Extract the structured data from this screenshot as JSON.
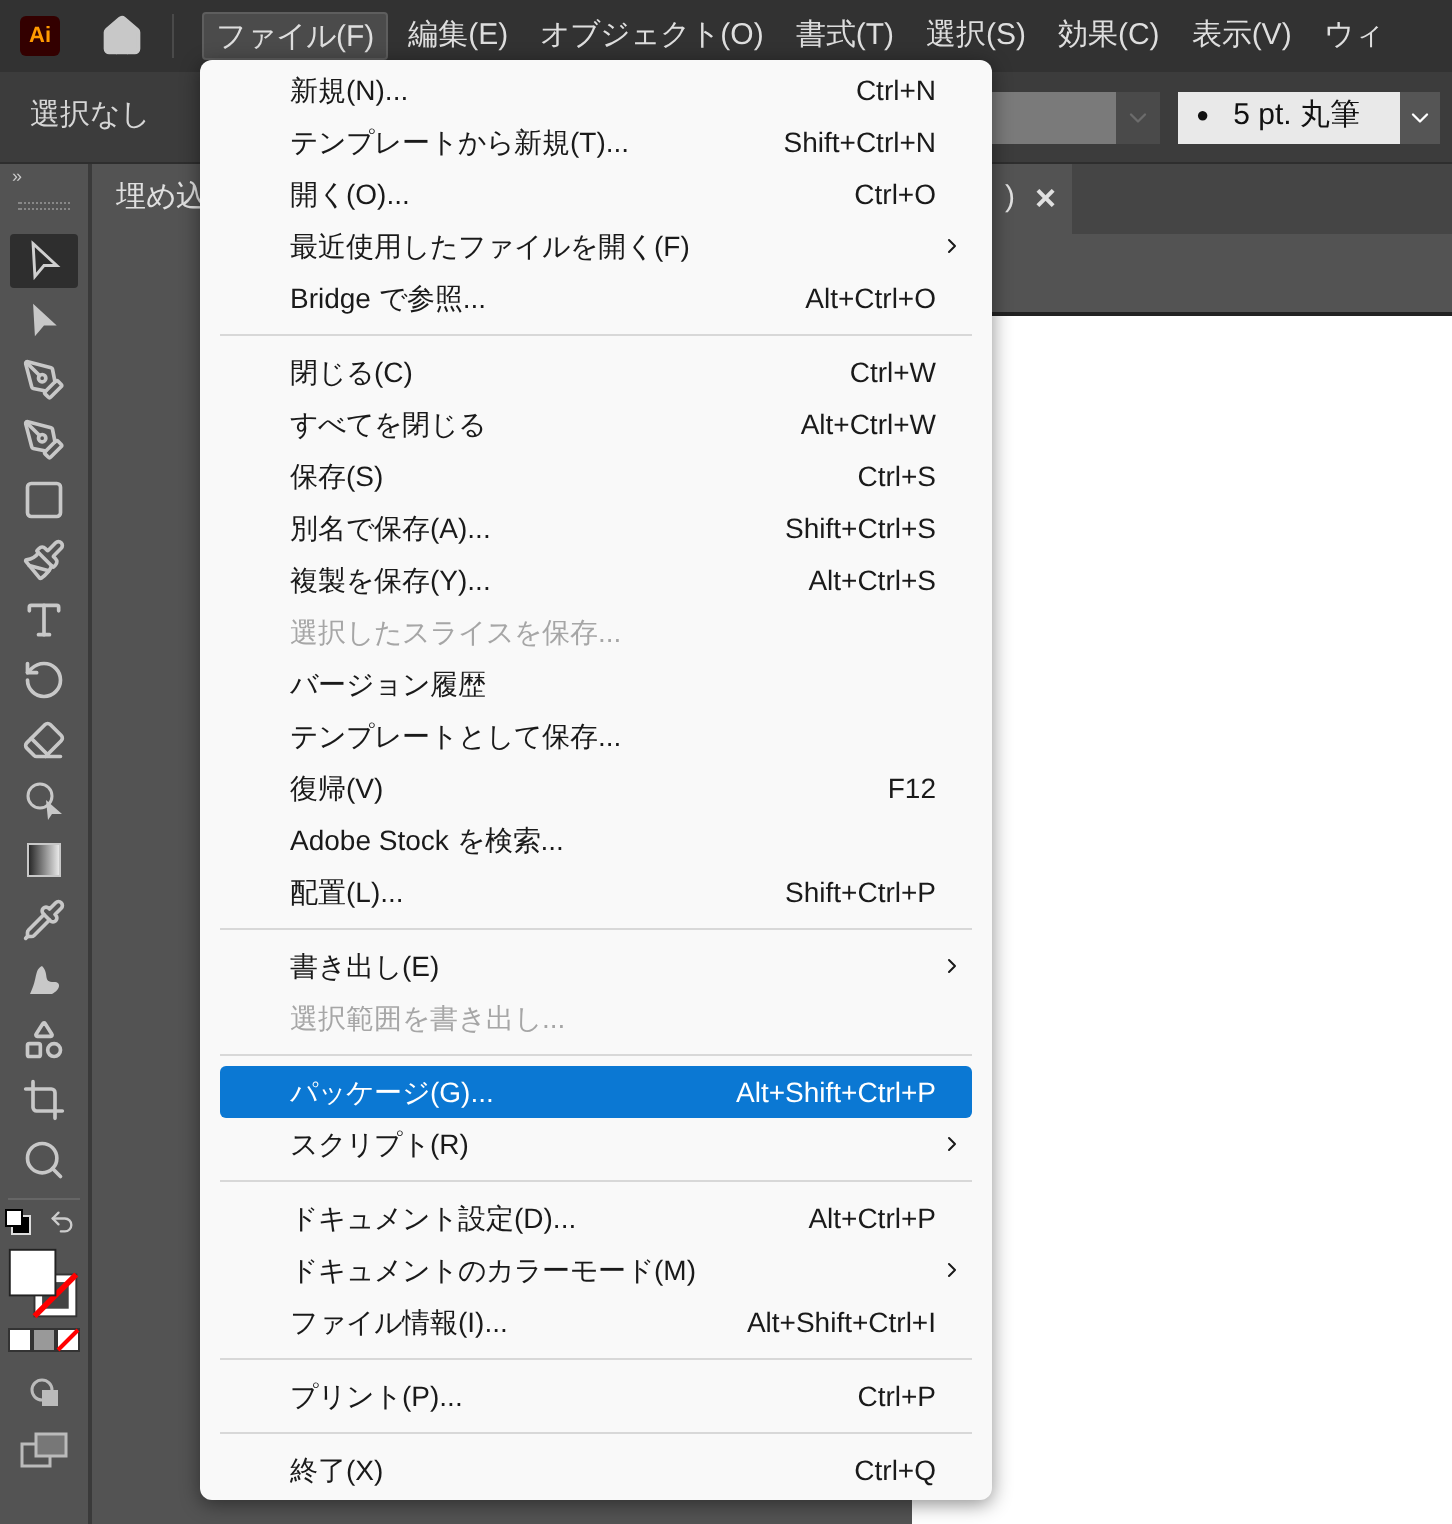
{
  "app_bar": {
    "logo": "Ai",
    "menus": [
      {
        "label": "ファイル(F)",
        "selected": true
      },
      {
        "label": "編集(E)",
        "selected": false
      },
      {
        "label": "オブジェクト(O)",
        "selected": false
      },
      {
        "label": "書式(T)",
        "selected": false
      },
      {
        "label": "選択(S)",
        "selected": false
      },
      {
        "label": "効果(C)",
        "selected": false
      },
      {
        "label": "表示(V)",
        "selected": false
      },
      {
        "label": "ウィ",
        "selected": false
      }
    ]
  },
  "control_bar": {
    "selection_status": "選択なし",
    "brush_field": {
      "bullet": "●",
      "value": "5 pt. 丸筆"
    }
  },
  "tools_panel": {
    "expand": "»"
  },
  "document_tab": {
    "title_start": "埋め込",
    "title_end": ")",
    "close": "×"
  },
  "tools": [
    {
      "kind": "selection",
      "selected": true
    },
    {
      "kind": "direct-selection",
      "selected": false
    },
    {
      "kind": "pen",
      "selected": false
    },
    {
      "kind": "curvature",
      "selected": false
    },
    {
      "kind": "rectangle",
      "selected": false
    },
    {
      "kind": "brush",
      "selected": false
    },
    {
      "kind": "type",
      "selected": false
    },
    {
      "kind": "rotate",
      "selected": false
    },
    {
      "kind": "eraser",
      "selected": false
    },
    {
      "kind": "shape-builder",
      "selected": false
    },
    {
      "kind": "gradient",
      "selected": false
    },
    {
      "kind": "eyedropper",
      "selected": false
    },
    {
      "kind": "puppet",
      "selected": false
    },
    {
      "kind": "shapes",
      "selected": false
    },
    {
      "kind": "artboard",
      "selected": false
    },
    {
      "kind": "zoom",
      "selected": false
    }
  ],
  "file_menu": {
    "items": [
      {
        "kind": "item",
        "label": "新規(N)...",
        "shortcut": "Ctrl+N",
        "submenu": false,
        "disabled": false,
        "selected": false
      },
      {
        "kind": "item",
        "label": "テンプレートから新規(T)...",
        "shortcut": "Shift+Ctrl+N",
        "submenu": false,
        "disabled": false,
        "selected": false
      },
      {
        "kind": "item",
        "label": "開く(O)...",
        "shortcut": "Ctrl+O",
        "submenu": false,
        "disabled": false,
        "selected": false
      },
      {
        "kind": "item",
        "label": "最近使用したファイルを開く(F)",
        "submenu": true,
        "disabled": false,
        "selected": false
      },
      {
        "kind": "item",
        "label": "Bridge で参照...",
        "shortcut": "Alt+Ctrl+O",
        "submenu": false,
        "disabled": false,
        "selected": false
      },
      {
        "kind": "separator"
      },
      {
        "kind": "item",
        "label": "閉じる(C)",
        "shortcut": "Ctrl+W",
        "submenu": false,
        "disabled": false,
        "selected": false
      },
      {
        "kind": "item",
        "label": "すべてを閉じる",
        "shortcut": "Alt+Ctrl+W",
        "submenu": false,
        "disabled": false,
        "selected": false
      },
      {
        "kind": "item",
        "label": "保存(S)",
        "shortcut": "Ctrl+S",
        "submenu": false,
        "disabled": false,
        "selected": false
      },
      {
        "kind": "item",
        "label": "別名で保存(A)...",
        "shortcut": "Shift+Ctrl+S",
        "submenu": false,
        "disabled": false,
        "selected": false
      },
      {
        "kind": "item",
        "label": "複製を保存(Y)...",
        "shortcut": "Alt+Ctrl+S",
        "submenu": false,
        "disabled": false,
        "selected": false
      },
      {
        "kind": "item",
        "label": "選択したスライスを保存...",
        "submenu": false,
        "disabled": true,
        "selected": false
      },
      {
        "kind": "item",
        "label": "バージョン履歴",
        "submenu": false,
        "disabled": false,
        "selected": false
      },
      {
        "kind": "item",
        "label": "テンプレートとして保存...",
        "submenu": false,
        "disabled": false,
        "selected": false
      },
      {
        "kind": "item",
        "label": "復帰(V)",
        "shortcut": "F12",
        "submenu": false,
        "disabled": false,
        "selected": false
      },
      {
        "kind": "item",
        "label": "Adobe Stock を検索...",
        "submenu": false,
        "disabled": false,
        "selected": false
      },
      {
        "kind": "item",
        "label": "配置(L)...",
        "shortcut": "Shift+Ctrl+P",
        "submenu": false,
        "disabled": false,
        "selected": false
      },
      {
        "kind": "separator"
      },
      {
        "kind": "item",
        "label": "書き出し(E)",
        "submenu": true,
        "disabled": false,
        "selected": false
      },
      {
        "kind": "item",
        "label": "選択範囲を書き出し...",
        "submenu": false,
        "disabled": true,
        "selected": false
      },
      {
        "kind": "separator"
      },
      {
        "kind": "item",
        "label": "パッケージ(G)...",
        "shortcut": "Alt+Shift+Ctrl+P",
        "submenu": false,
        "disabled": false,
        "selected": true
      },
      {
        "kind": "item",
        "label": "スクリプト(R)",
        "submenu": true,
        "disabled": false,
        "selected": false
      },
      {
        "kind": "separator"
      },
      {
        "kind": "item",
        "label": "ドキュメント設定(D)...",
        "shortcut": "Alt+Ctrl+P",
        "submenu": false,
        "disabled": false,
        "selected": false
      },
      {
        "kind": "item",
        "label": "ドキュメントのカラーモード(M)",
        "submenu": true,
        "disabled": false,
        "selected": false
      },
      {
        "kind": "item",
        "label": "ファイル情報(I)...",
        "shortcut": "Alt+Shift+Ctrl+I",
        "submenu": false,
        "disabled": false,
        "selected": false
      },
      {
        "kind": "separator"
      },
      {
        "kind": "item",
        "label": "プリント(P)...",
        "shortcut": "Ctrl+P",
        "submenu": false,
        "disabled": false,
        "selected": false
      },
      {
        "kind": "separator"
      },
      {
        "kind": "item",
        "label": "終了(X)",
        "shortcut": "Ctrl+Q",
        "submenu": false,
        "disabled": false,
        "selected": false
      }
    ]
  }
}
